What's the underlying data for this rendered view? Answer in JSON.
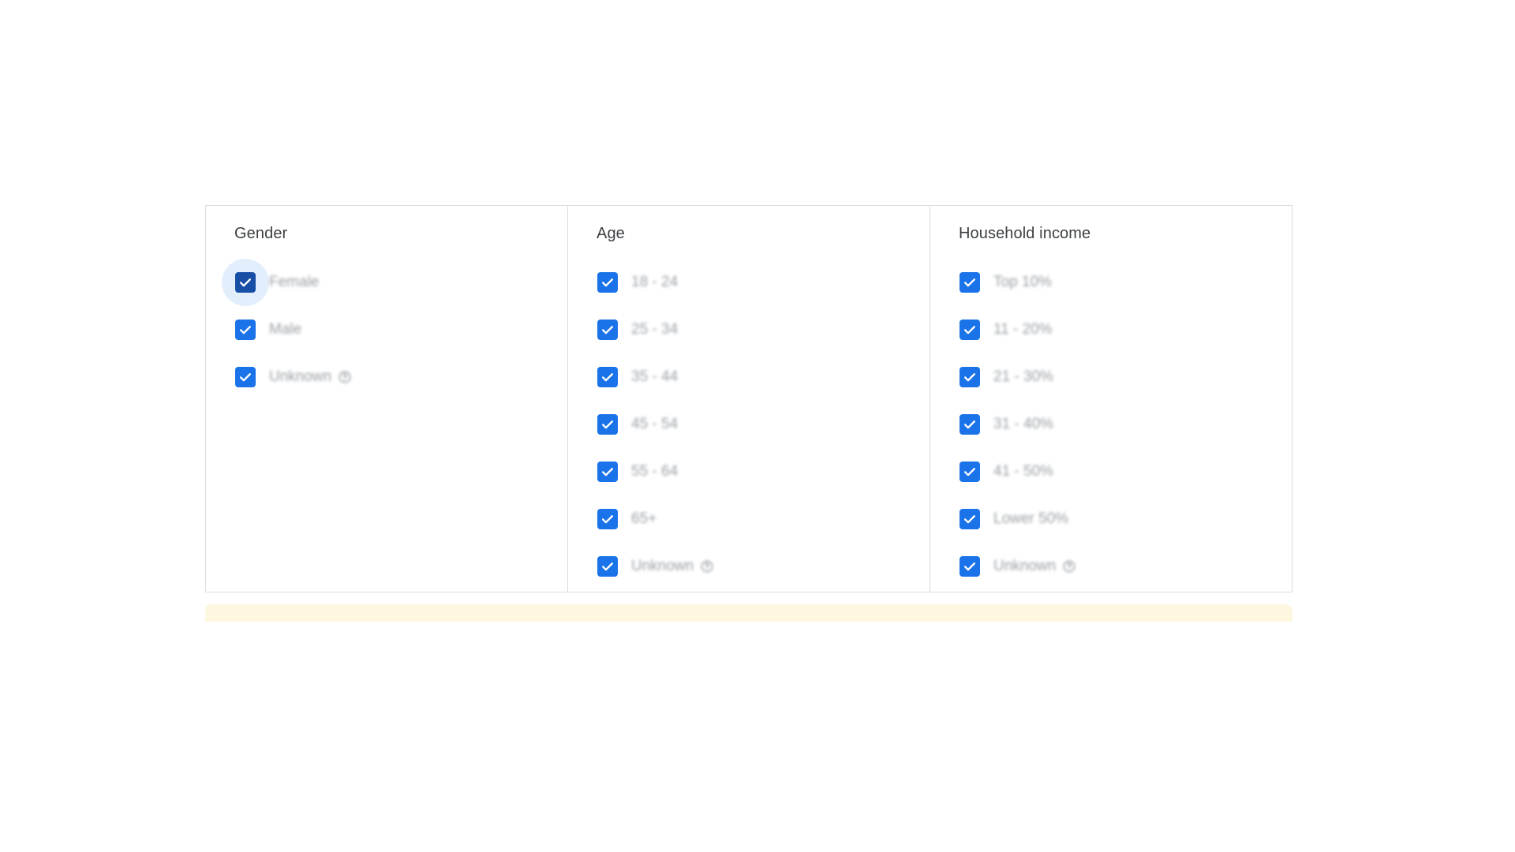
{
  "accent_color": "#1a73e8",
  "warning_color": "#fef7e0",
  "columns": [
    {
      "title": "Gender",
      "options": [
        {
          "label": "Female",
          "checked": true,
          "help": false
        },
        {
          "label": "Male",
          "checked": true,
          "help": false
        },
        {
          "label": "Unknown",
          "checked": true,
          "help": true
        }
      ]
    },
    {
      "title": "Age",
      "options": [
        {
          "label": "18 - 24",
          "checked": true,
          "help": false
        },
        {
          "label": "25 - 34",
          "checked": true,
          "help": false
        },
        {
          "label": "35 - 44",
          "checked": true,
          "help": false
        },
        {
          "label": "45 - 54",
          "checked": true,
          "help": false
        },
        {
          "label": "55 - 64",
          "checked": true,
          "help": false
        },
        {
          "label": "65+",
          "checked": true,
          "help": false
        },
        {
          "label": "Unknown",
          "checked": true,
          "help": true
        }
      ]
    },
    {
      "title": "Household income",
      "options": [
        {
          "label": "Top 10%",
          "checked": true,
          "help": false
        },
        {
          "label": "11 - 20%",
          "checked": true,
          "help": false
        },
        {
          "label": "21 - 30%",
          "checked": true,
          "help": false
        },
        {
          "label": "31 - 40%",
          "checked": true,
          "help": false
        },
        {
          "label": "41 - 50%",
          "checked": true,
          "help": false
        },
        {
          "label": "Lower 50%",
          "checked": true,
          "help": false
        },
        {
          "label": "Unknown",
          "checked": true,
          "help": true
        }
      ]
    }
  ],
  "icons": {
    "checkbox": "check-icon",
    "help": "help-circle-icon"
  }
}
